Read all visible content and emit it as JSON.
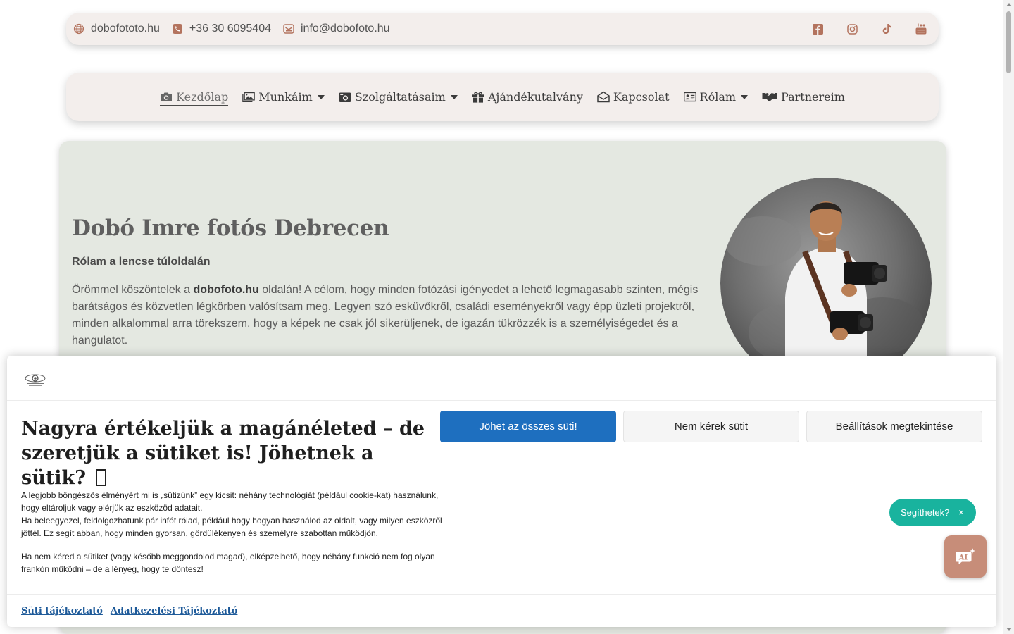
{
  "topbar": {
    "website": "dobofototo.hu",
    "phone": "+36 30 6095404",
    "email": "info@dobofoto.hu",
    "icon_color": "#b3735e",
    "socials": [
      "facebook-icon",
      "instagram-icon",
      "tiktok-icon",
      "youtube-icon"
    ]
  },
  "nav": {
    "items": [
      {
        "label": "Kezdőlap",
        "icon": "camera-icon",
        "active": true
      },
      {
        "label": "Munkáim",
        "icon": "images-icon",
        "dropdown": true
      },
      {
        "label": "Szolgáltatásaim",
        "icon": "camera-retro-icon",
        "dropdown": true
      },
      {
        "label": "Ajándékutalvány",
        "icon": "gift-icon"
      },
      {
        "label": "Kapcsolat",
        "icon": "envelope-open-icon"
      },
      {
        "label": "Rólam",
        "icon": "id-card-icon",
        "dropdown": true
      },
      {
        "label": "Partnereim",
        "icon": "handshake-icon"
      }
    ]
  },
  "hero": {
    "title": "Dobó Imre fotós Debrecen",
    "subtitle": "Rólam a lencse túloldalán",
    "text_before": "Örömmel köszöntelek a ",
    "text_bold": "dobofoto.hu",
    "text_after": " oldalán! A célom, hogy minden fotózási igényedet a lehető legmagasabb szinten, mégis barátságos és közvetlen légkörben valósítsam meg. Legyen szó esküvőkről, családi eseményekről vagy épp üzleti projektről, minden alkalommal arra törekszem, hogy a képek ne csak jól sikerüljenek, de igazán tükrözzék is a személyiségedet és a hangulatot.",
    "background": "#e4e8e1"
  },
  "cookie": {
    "title": "Nagyra értékeljük a magánéleted – de szeretjük a sütiket is! Jöhetnek a sütik?",
    "p1_line1": "A legjobb böngészős élményért mi is „sütizünk” egy kicsit: néhány technológiát (például cookie-kat) használunk, hogy eltároljuk vagy elérjük az eszközöd adatait.",
    "p1_line2": "Ha beleegyezel, feldolgozhatunk pár infót rólad, például hogy hogyan használod az oldalt, vagy milyen eszközről jöttél. Ez segít abban, hogy minden gyorsan, gördülékenyen és személyre szabottan működjön.",
    "p2": "Ha nem kéred a sütiket (vagy később meggondolod magad), elképzelhető, hogy néhány funkció nem fog olyan frankón működni – de a lényeg, hogy te döntesz!",
    "accept": "Jöhet az összes süti!",
    "reject": "Nem kérek sütit",
    "settings": "Beállítások megtekintése",
    "link_cookie": "Süti tájékoztató",
    "link_privacy": "Adatkezelési Tájékoztató",
    "accent": "#1e6fbf"
  },
  "chat": {
    "bubble": "Segíthetek?",
    "close": "×",
    "button_label": "AI",
    "bubble_color": "#19b39e",
    "button_color": "#c78d79"
  }
}
